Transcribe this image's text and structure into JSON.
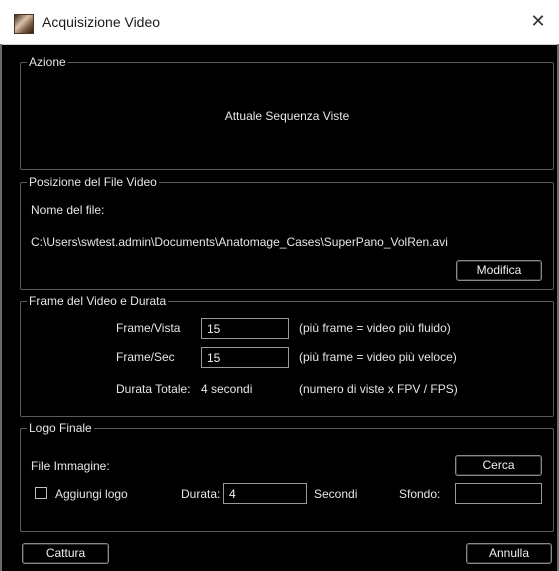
{
  "window": {
    "title": "Acquisizione Video",
    "close_glyph": "✕"
  },
  "azione": {
    "legend": "Azione",
    "text": "Attuale Sequenza Viste"
  },
  "posizione": {
    "legend": "Posizione del File Video",
    "nome_label": "Nome del file:",
    "path": "C:\\Users\\swtest.admin\\Documents\\Anatomage_Cases\\SuperPano_VolRen.avi",
    "modifica_label": "Modifica"
  },
  "frame": {
    "legend": "Frame del Video e Durata",
    "frame_vista_label": "Frame/Vista",
    "frame_vista_value": "15",
    "frame_vista_hint": "(più frame = video più fluido)",
    "frame_sec_label": "Frame/Sec",
    "frame_sec_value": "15",
    "frame_sec_hint": "(più frame = video più veloce)",
    "durata_label": "Durata Totale:",
    "durata_value": "4 secondi",
    "durata_hint": "(numero di viste x FPV / FPS)"
  },
  "logo": {
    "legend": "Logo Finale",
    "file_label": "File Immagine:",
    "cerca_label": "Cerca",
    "aggiungi_label": "Aggiungi logo",
    "aggiungi_checked": false,
    "durata_label": "Durata:",
    "durata_value": "4",
    "secondi_label": "Secondi",
    "sfondo_label": "Sfondo:",
    "sfondo_value": ""
  },
  "footer": {
    "cattura_label": "Cattura",
    "annulla_label": "Annulla"
  }
}
